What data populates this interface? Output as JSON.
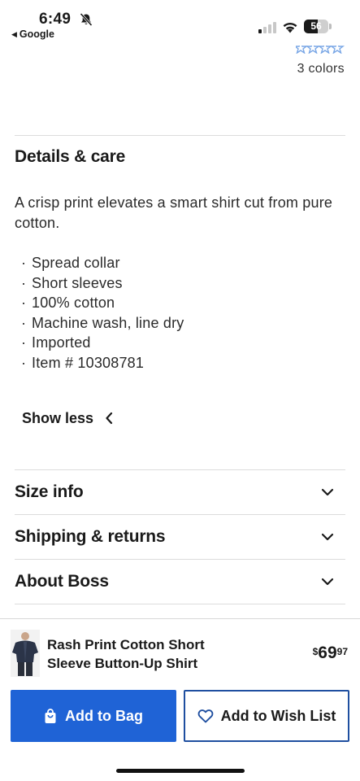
{
  "status_bar": {
    "time": "6:49",
    "back_app": "Google",
    "battery": "56",
    "battery_level": 0.56
  },
  "product_meta": {
    "colors_text": "3 colors"
  },
  "details": {
    "title": "Details & care",
    "description": "A crisp print elevates a smart shirt cut from pure cotton.",
    "bullets": [
      "Spread collar",
      "Short sleeves",
      "100% cotton",
      "Machine wash, line dry",
      "Imported",
      "Item # 10308781"
    ],
    "show_less_label": "Show less"
  },
  "accordions": [
    {
      "title": "Size info"
    },
    {
      "title": "Shipping & returns"
    },
    {
      "title": "About Boss"
    }
  ],
  "sticky_bar": {
    "product_name": "Rash Print Cotton Short Sleeve Button-Up Shirt",
    "price": {
      "currency": "$",
      "dollars": "69",
      "cents": "97"
    },
    "add_to_bag_label": "Add to Bag",
    "add_to_wishlist_label": "Add to Wish List"
  },
  "colors": {
    "primary_button": "#1f63d6",
    "wishlist_border": "#1f4fa0",
    "star": "#7aa7e6"
  }
}
